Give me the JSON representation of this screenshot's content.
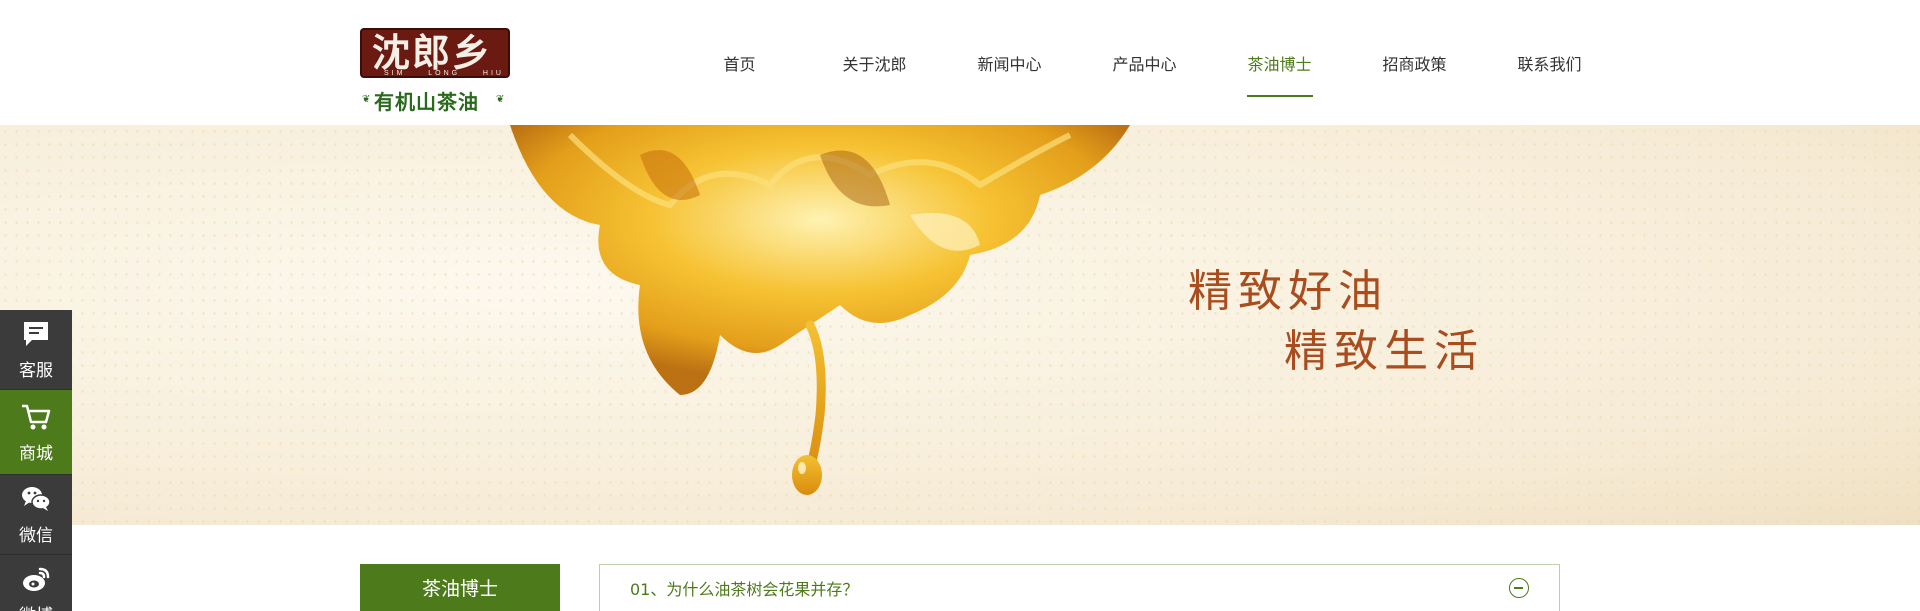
{
  "logo": {
    "brand": "沈郎乡",
    "pinyin": [
      "SIM",
      "LONG",
      "HIU"
    ],
    "subtitle": "有机山茶油"
  },
  "nav": {
    "items": [
      {
        "label": "首页"
      },
      {
        "label": "关于沈郎"
      },
      {
        "label": "新闻中心"
      },
      {
        "label": "产品中心"
      },
      {
        "label": "茶油博士",
        "active": true
      },
      {
        "label": "招商政策"
      },
      {
        "label": "联系我们"
      }
    ]
  },
  "banner": {
    "line1": "精致好油",
    "line2": "精致生活"
  },
  "sidebar": {
    "title": "茶油博士"
  },
  "faq": {
    "items": [
      {
        "question": "01、为什么油茶树会花果并存？",
        "expanded": true
      }
    ]
  },
  "float_bar": {
    "items": [
      {
        "label": "客服",
        "icon": "chat-icon"
      },
      {
        "label": "商城",
        "icon": "cart-icon"
      },
      {
        "label": "微信",
        "icon": "wechat-icon"
      },
      {
        "label": "微博",
        "icon": "weibo-icon"
      }
    ]
  },
  "colors": {
    "accent_green": "#4d7a1a",
    "slogan_brown": "#a94d1e",
    "float_dark": "#3b3b3b"
  }
}
